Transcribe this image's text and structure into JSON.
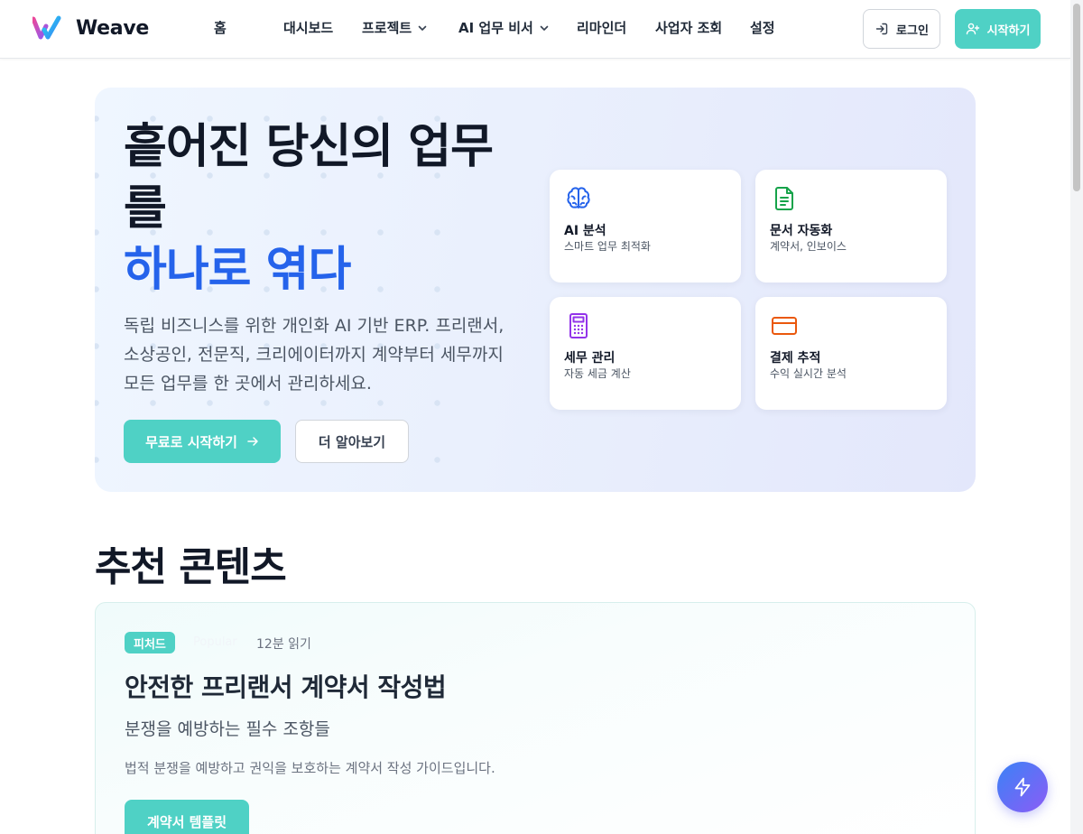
{
  "header": {
    "brand": "Weave",
    "nav": [
      {
        "label": "홈"
      },
      {
        "label": "대시보드"
      },
      {
        "label": "프로젝트",
        "has_dropdown": true
      },
      {
        "label": "AI 업무 비서",
        "has_dropdown": true
      },
      {
        "label": "리마인더"
      },
      {
        "label": "사업자 조회"
      },
      {
        "label": "설정"
      }
    ],
    "login_label": "로그인",
    "start_label": "시작하기"
  },
  "hero": {
    "title_line1": "흩어진 당신의 업무",
    "title_line2": "를",
    "title_accent": "하나로 엮다",
    "description": "독립 비즈니스를 위한 개인화 AI 기반 ERP. 프리랜서, 소상공인, 전문직, 크리에이터까지 계약부터 세무까지 모든 업무를 한 곳에서 관리하세요.",
    "cta_primary": "무료로 시작하기",
    "cta_secondary": "더 알아보기",
    "features": [
      {
        "title": "AI 분석",
        "subtitle": "스마트 업무 최적화",
        "icon": "brain-icon",
        "color": "#2563eb"
      },
      {
        "title": "문서 자동화",
        "subtitle": "계약서, 인보이스",
        "icon": "document-icon",
        "color": "#16a34a"
      },
      {
        "title": "세무 관리",
        "subtitle": "자동 세금 계산",
        "icon": "calculator-icon",
        "color": "#9333ea"
      },
      {
        "title": "결제 추적",
        "subtitle": "수익 실시간 분석",
        "icon": "credit-card-icon",
        "color": "#ea580c"
      }
    ]
  },
  "recommended": {
    "section_title": "추천 콘텐츠",
    "featured": {
      "badge": "피처드",
      "category": "Popular",
      "read_time": "12분 읽기",
      "title": "안전한 프리랜서 계약서 작성법",
      "subtitle": "분쟁을 예방하는 필수 조항들",
      "description": "법적 분쟁을 예방하고 권익을 보호하는 계약서 작성 가이드입니다.",
      "button": "계약서 템플릿"
    }
  },
  "colors": {
    "primary": "#4fd1c5",
    "accent_blue": "#2563eb",
    "fab_gradient_start": "#3b82f6",
    "fab_gradient_end": "#8b5cf6"
  },
  "fab": {
    "icon": "lightning-icon"
  }
}
